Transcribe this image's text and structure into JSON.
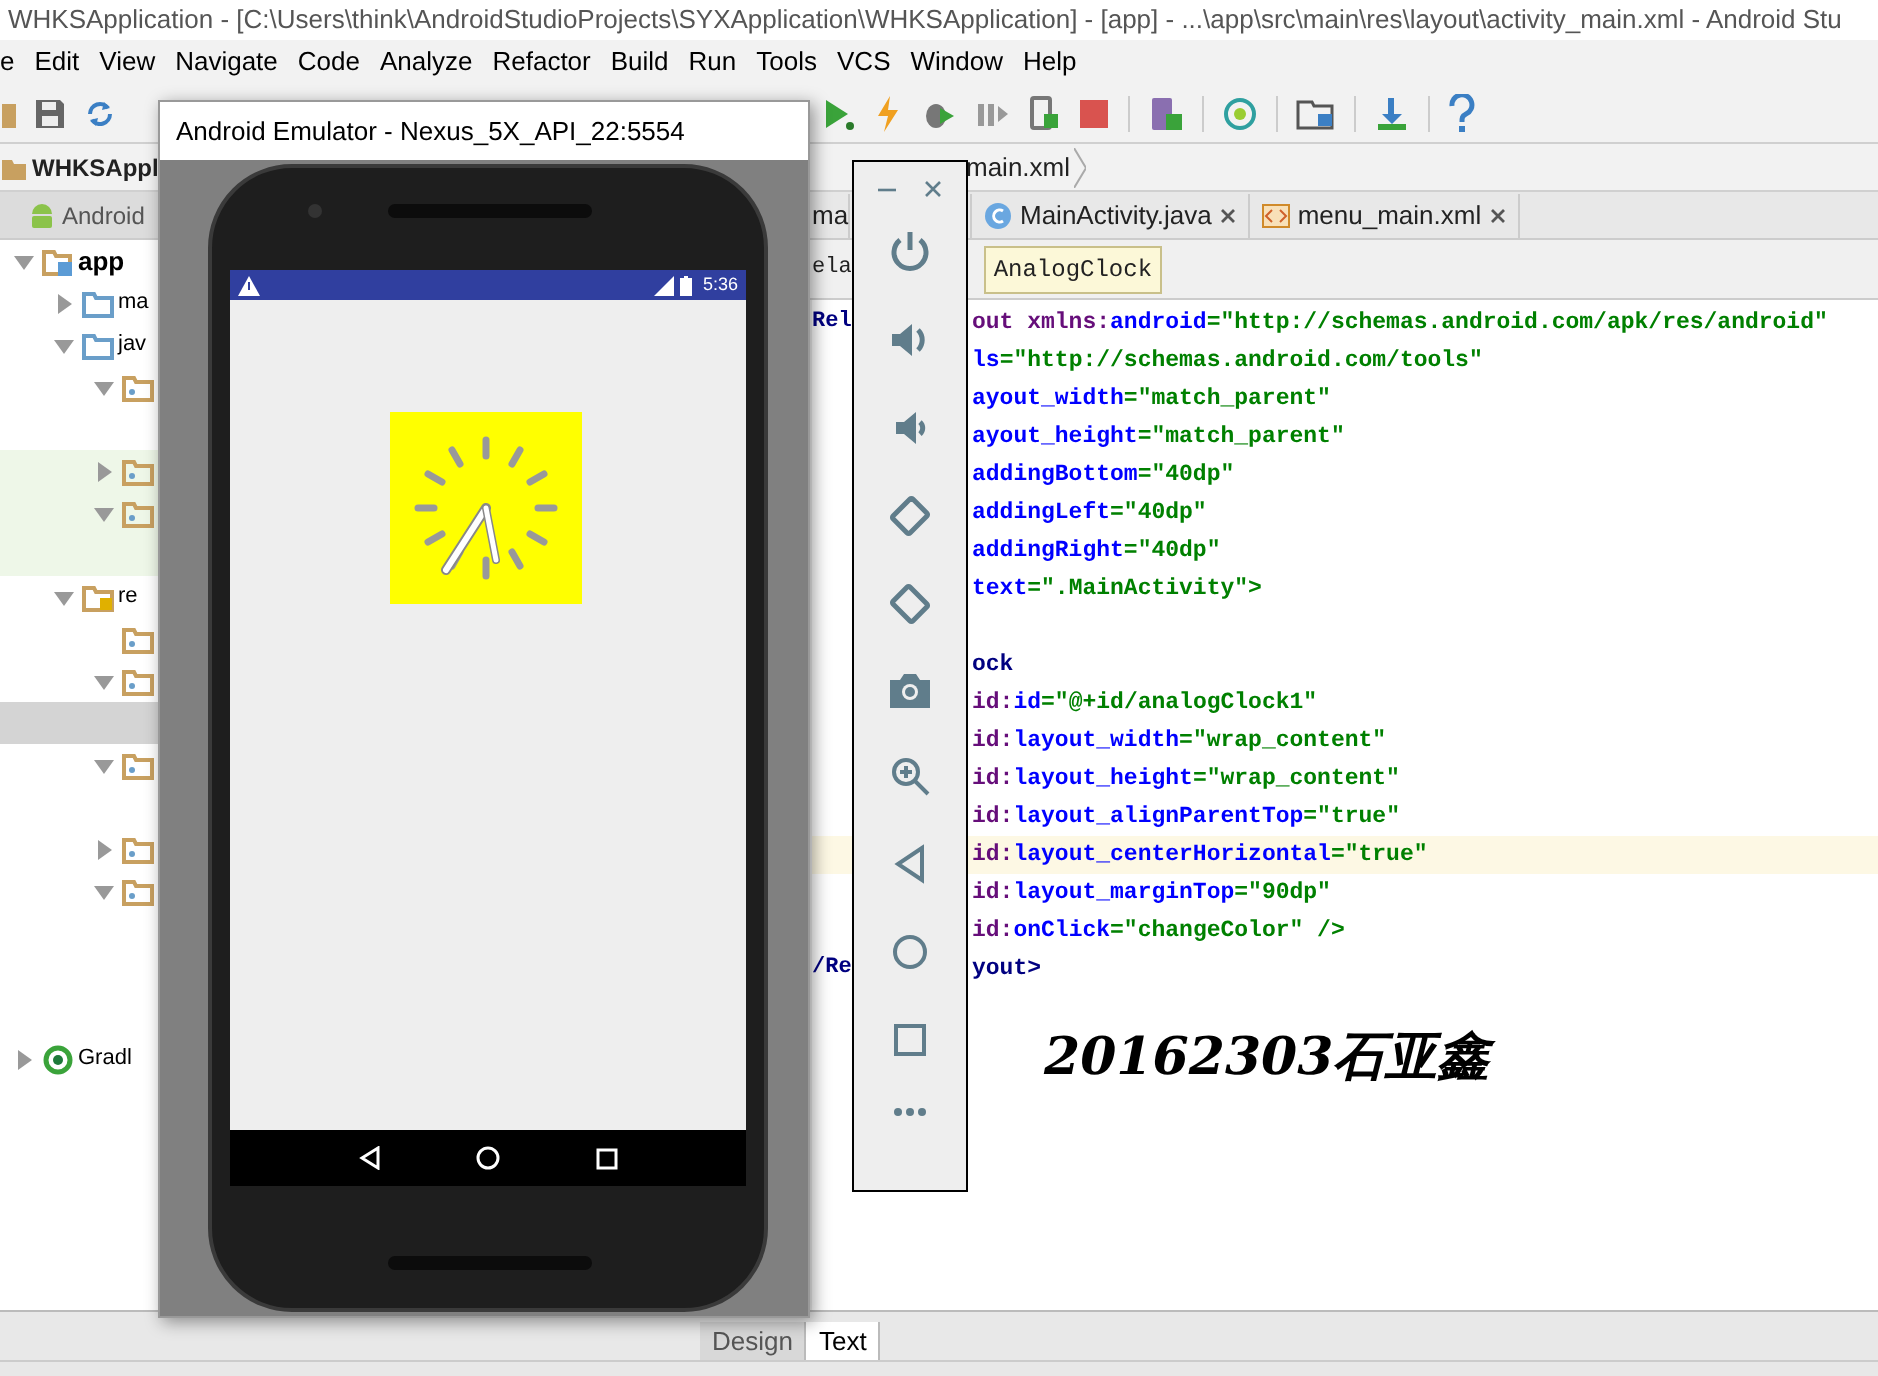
{
  "window": {
    "title": "WHKSApplication - [C:\\Users\\think\\AndroidStudioProjects\\SYXApplication\\WHKSApplication] - [app] - ...\\app\\src\\main\\res\\layout\\activity_main.xml - Android Stu"
  },
  "menu": [
    "e",
    "Edit",
    "View",
    "Navigate",
    "Code",
    "Analyze",
    "Refactor",
    "Build",
    "Run",
    "Tools",
    "VCS",
    "Window",
    "Help"
  ],
  "nav_bar": {
    "project": "WHKSAppl",
    "file": "main.xml"
  },
  "project_panel": {
    "view": "Android",
    "tree": [
      {
        "label": "app",
        "kind": "module",
        "expanded": true,
        "selected": false,
        "children": [
          {
            "label": "ma",
            "kind": "source",
            "expanded": false,
            "selected": false
          },
          {
            "label": "jav",
            "kind": "source",
            "expanded": true,
            "selected": false,
            "children": [
              {
                "kind": "package",
                "expanded": true,
                "selected": false,
                "children": [
                  {
                    "selected": false
                  }
                ]
              },
              {
                "kind": "package",
                "expanded": false,
                "selected": false,
                "tinted": true
              },
              {
                "kind": "package",
                "expanded": true,
                "selected": false,
                "tinted": true,
                "children": [
                  {
                    "selected": false
                  }
                ]
              }
            ]
          },
          {
            "label": "re",
            "kind": "res",
            "expanded": true,
            "selected": false,
            "children": [
              {
                "kind": "package",
                "selected": false
              },
              {
                "kind": "package",
                "expanded": true,
                "selected": false,
                "children": [
                  {
                    "selected": true
                  }
                ]
              },
              {
                "kind": "package",
                "expanded": true,
                "selected": false,
                "children": [
                  {
                    "selected": false
                  }
                ]
              },
              {
                "kind": "package",
                "expanded": false,
                "selected": false
              },
              {
                "kind": "package",
                "expanded": true,
                "selected": false,
                "children": [
                  {
                    "selected": false
                  },
                  {
                    "selected": false
                  },
                  {
                    "selected": false
                  }
                ]
              }
            ]
          }
        ]
      },
      {
        "label": "Gradl",
        "kind": "gradle",
        "expanded": false,
        "selected": false
      }
    ]
  },
  "editor": {
    "tabs": [
      {
        "label": "ma",
        "selected": false
      },
      {
        "label": "MainActivity.java",
        "kind": "java",
        "selected": false
      },
      {
        "label": "menu_main.xml",
        "kind": "xml",
        "selected": false
      }
    ],
    "breadcrumbs": [
      "ela",
      "AnalogClock"
    ],
    "lines": [
      {
        "left": "Rel",
        "text": "out xmlns:android=\"http://schemas.android.com/apk/res/android\"",
        "highlighted": false
      },
      {
        "text": "ls=\"http://schemas.android.com/tools\"",
        "highlighted": false
      },
      {
        "text": "ayout_width=\"match_parent\"",
        "highlighted": false
      },
      {
        "text": "ayout_height=\"match_parent\"",
        "highlighted": false
      },
      {
        "text": "addingBottom=\"40dp\"",
        "highlighted": false
      },
      {
        "text": "addingLeft=\"40dp\"",
        "highlighted": false
      },
      {
        "text": "addingRight=\"40dp\"",
        "highlighted": false
      },
      {
        "text": "text=\".MainActivity\">",
        "highlighted": false
      },
      {
        "highlighted": false
      },
      {
        "text": "ock",
        "highlighted": false
      },
      {
        "text": "id:id=\"@+id/analogClock1\"",
        "highlighted": false
      },
      {
        "text": "id:layout_width=\"wrap_content\"",
        "highlighted": false
      },
      {
        "text": "id:layout_height=\"wrap_content\"",
        "highlighted": false
      },
      {
        "text": "id:layout_alignParentTop=\"true\"",
        "highlighted": false
      },
      {
        "text": "id:layout_centerHorizontal=\"true\"",
        "highlighted": true
      },
      {
        "text": "id:layout_marginTop=\"90dp\"",
        "highlighted": false
      },
      {
        "text": "id:onClick=\"changeColor\" />",
        "highlighted": false
      },
      {
        "left": "/Re",
        "text": "yout>",
        "highlighted": false
      }
    ],
    "overlay_text": "20162303石亚鑫",
    "bottom_tabs": [
      {
        "label": "Design",
        "selected": false
      },
      {
        "label": "Text",
        "selected": true
      }
    ]
  },
  "emulator": {
    "title": "Android Emulator - Nexus_5X_API_22:5554",
    "status_time": "5:36"
  }
}
